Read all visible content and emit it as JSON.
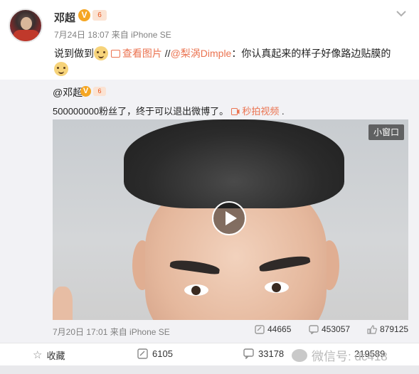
{
  "post": {
    "username": "邓超",
    "verified_badge": "V",
    "level_badge": "6",
    "meta": "7月24日 18:07 来自 iPhone SE",
    "text_a": "说到做到",
    "link_image": "查看图片",
    "slashes": " //",
    "mention": "@梨涡Dimple",
    "text_b": "：你认真起来的样子好像路边贴膜的"
  },
  "repost": {
    "username": "@邓超",
    "verified_badge": "V",
    "level_badge": "6",
    "text": "500000000粉丝了，终于可以退出微博了。",
    "video_link": "秒拍视频",
    "video_link_suffix": " .",
    "mini_window_label": "小窗口",
    "meta": "7月20日 17:01 来自 iPhone SE",
    "stats": {
      "reposts": "44665",
      "comments": "453057",
      "likes": "879125"
    }
  },
  "actions": {
    "favorite_label": "收藏",
    "repost_count": "6105",
    "comment_count": "33178",
    "like_count": "219589"
  },
  "watermark": "微信号: dc418",
  "colors": {
    "accent": "#eb7350",
    "badge": "#f5a623",
    "meta_gray": "#808080",
    "repost_bg": "#f2f2f5"
  },
  "icons": [
    "avatar",
    "verified-icon",
    "level-icon",
    "chevron-down-icon",
    "emoji-icon",
    "image-icon",
    "video-icon",
    "play-icon",
    "repost-icon",
    "comment-icon",
    "like-icon",
    "star-icon",
    "wechat-icon"
  ]
}
